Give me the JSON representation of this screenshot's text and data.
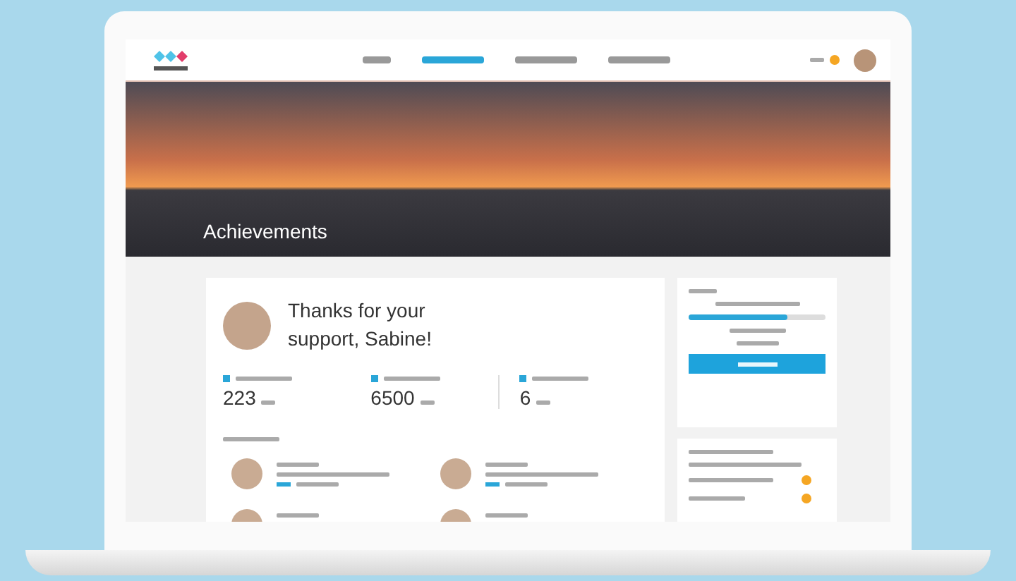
{
  "nav": {
    "items": [
      {
        "selected": false
      },
      {
        "selected": true
      },
      {
        "selected": false
      },
      {
        "selected": false
      }
    ]
  },
  "hero": {
    "title": "Achievements"
  },
  "thanks": {
    "message": "Thanks for your support, Sabine!"
  },
  "stats": [
    {
      "value": "223"
    },
    {
      "value": "6500"
    },
    {
      "value": "6"
    }
  ],
  "progress": {
    "level": 0.72
  }
}
